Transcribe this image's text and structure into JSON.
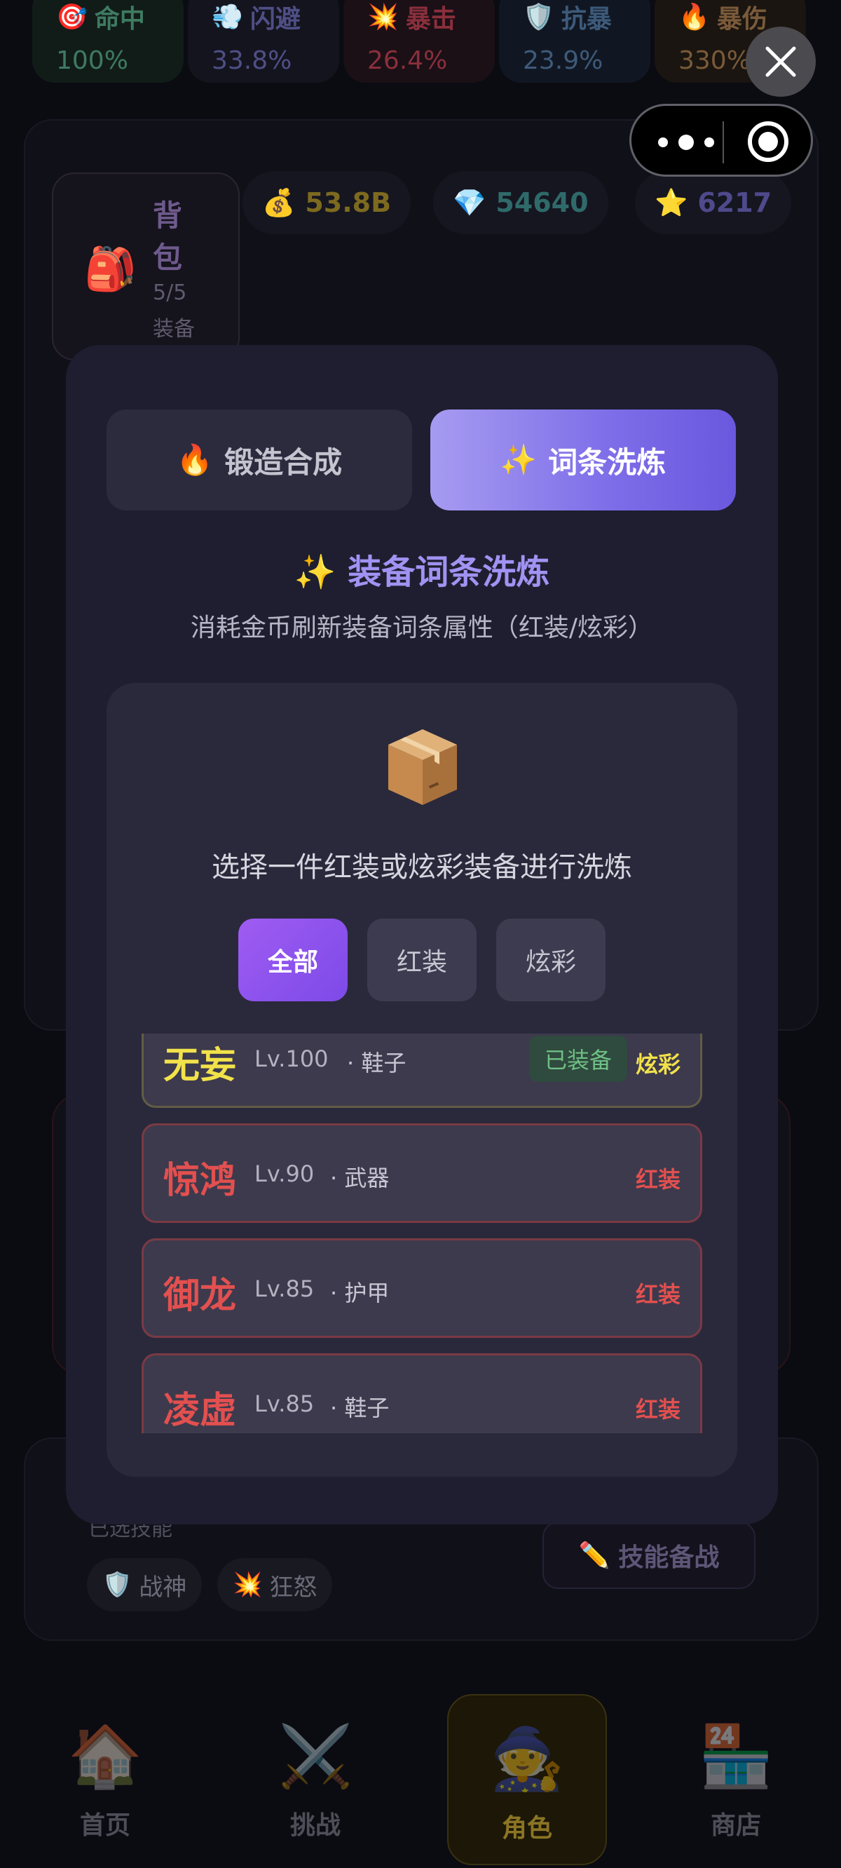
{
  "stats": [
    {
      "icon": "🎯",
      "label": "命中",
      "value": "100%",
      "color": "#3f7a62",
      "bg": "#111c19"
    },
    {
      "icon": "💨",
      "label": "闪避",
      "value": "33.8%",
      "color": "#4f4f86",
      "bg": "#14141f"
    },
    {
      "icon": "💥",
      "label": "暴击",
      "value": "26.4%",
      "color": "#8a2f3c",
      "bg": "#1a1016"
    },
    {
      "icon": "🛡️",
      "label": "抗暴",
      "value": "23.9%",
      "color": "#3d5a7a",
      "bg": "#111722"
    },
    {
      "icon": "🔥",
      "label": "暴伤",
      "value": "330%",
      "color": "#7a5a3a",
      "bg": "#1a1510"
    }
  ],
  "bag": {
    "icon": "🎒",
    "title": "背包",
    "count": "5/5",
    "sub": "装备"
  },
  "currencies": [
    {
      "icon": "💰",
      "value": "53.8B",
      "color": "#7d6a1f"
    },
    {
      "icon": "💎",
      "value": "54640",
      "color": "#2f6a6a"
    },
    {
      "icon": "⭐",
      "value": "6217",
      "color": "#4f4a8c"
    }
  ],
  "skills": {
    "label": "已选技能",
    "tags": [
      {
        "icon": "🛡️",
        "label": "战神"
      },
      {
        "icon": "💥",
        "label": "狂怒"
      }
    ],
    "prepare_button": {
      "icon": "✏️",
      "label": "技能备战"
    }
  },
  "tabbar": [
    {
      "icon": "🏠",
      "label": "首页"
    },
    {
      "icon": "⚔️",
      "label": "挑战"
    },
    {
      "icon": "🧙",
      "label": "角色",
      "active": true
    },
    {
      "icon": "🏪",
      "label": "商店"
    }
  ],
  "modal": {
    "tabs": {
      "forge": {
        "icon": "🔥",
        "label": "锻造合成"
      },
      "refine": {
        "icon": "✨",
        "label": "词条洗炼"
      }
    },
    "title": "装备词条洗炼",
    "title_icon": "✨",
    "subtitle": "消耗金币刷新装备词条属性（红装/炫彩）",
    "prompt": "选择一件红装或炫彩装备进行洗炼",
    "filters": [
      "全部",
      "红装",
      "炫彩"
    ],
    "items": [
      {
        "name": "无妄",
        "level": "Lv.100",
        "slot": "· 鞋子",
        "equipped": "已装备",
        "rarity": "炫彩",
        "type": "dazzle"
      },
      {
        "name": "惊鸿",
        "level": "Lv.90",
        "slot": "· 武器",
        "equipped": "",
        "rarity": "红装",
        "type": "red"
      },
      {
        "name": "御龙",
        "level": "Lv.85",
        "slot": "· 护甲",
        "equipped": "",
        "rarity": "红装",
        "type": "red"
      },
      {
        "name": "凌虚",
        "level": "Lv.85",
        "slot": "· 鞋子",
        "equipped": "",
        "rarity": "红装",
        "type": "red"
      }
    ]
  },
  "colors": {
    "accent": "#7d6de8",
    "red_gear": "#e2504f",
    "dazzle_gear": "#f2e24a"
  }
}
